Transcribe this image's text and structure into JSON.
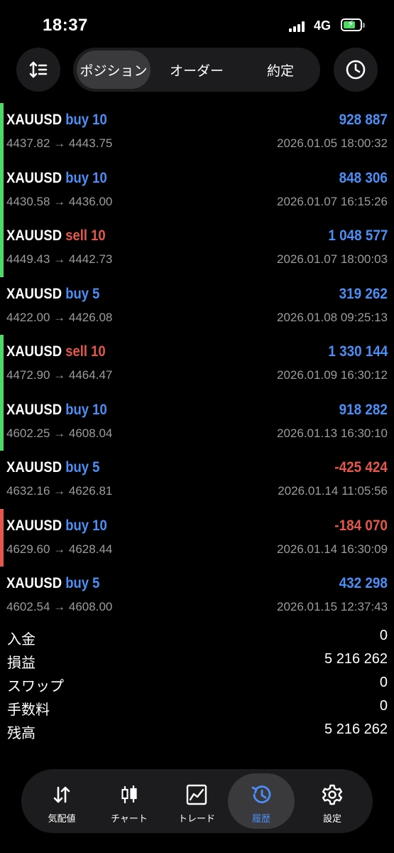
{
  "status_bar": {
    "time": "18:37",
    "network": "4G"
  },
  "tabs": [
    {
      "label": "ポジション",
      "active": true
    },
    {
      "label": "オーダー",
      "active": false
    },
    {
      "label": "約定",
      "active": false
    }
  ],
  "rows": [
    {
      "symbol": "XAUUSD",
      "side": "buy 10",
      "side_type": "buy",
      "prices": "4437.82 → 4443.75",
      "profit": "928 887",
      "profit_sign": "pos",
      "date": "2026.01.05 18:00:32",
      "bar": "#4cd964"
    },
    {
      "symbol": "XAUUSD",
      "side": "buy 10",
      "side_type": "buy",
      "prices": "4430.58 → 4436.00",
      "profit": "848 306",
      "profit_sign": "pos",
      "date": "2026.01.07 16:15:26",
      "bar": "#4cd964"
    },
    {
      "symbol": "XAUUSD",
      "side": "sell 10",
      "side_type": "sell",
      "prices": "4449.43 → 4442.73",
      "profit": "1 048 577",
      "profit_sign": "pos",
      "date": "2026.01.07 18:00:03",
      "bar": "#4cd964"
    },
    {
      "symbol": "XAUUSD",
      "side": "buy 5",
      "side_type": "buy",
      "prices": "4422.00 → 4426.08",
      "profit": "319 262",
      "profit_sign": "pos",
      "date": "2026.01.08 09:25:13",
      "bar": ""
    },
    {
      "symbol": "XAUUSD",
      "side": "sell 10",
      "side_type": "sell",
      "prices": "4472.90 → 4464.47",
      "profit": "1 330 144",
      "profit_sign": "pos",
      "date": "2026.01.09 16:30:12",
      "bar": "#4cd964"
    },
    {
      "symbol": "XAUUSD",
      "side": "buy 10",
      "side_type": "buy",
      "prices": "4602.25 → 4608.04",
      "profit": "918 282",
      "profit_sign": "pos",
      "date": "2026.01.13 16:30:10",
      "bar": "#4cd964"
    },
    {
      "symbol": "XAUUSD",
      "side": "buy 5",
      "side_type": "buy",
      "prices": "4632.16 → 4626.81",
      "profit": "-425 424",
      "profit_sign": "neg",
      "date": "2026.01.14 11:05:56",
      "bar": ""
    },
    {
      "symbol": "XAUUSD",
      "side": "buy 10",
      "side_type": "buy",
      "prices": "4629.60 → 4628.44",
      "profit": "-184 070",
      "profit_sign": "neg",
      "date": "2026.01.14 16:30:09",
      "bar": "#e5574b"
    },
    {
      "symbol": "XAUUSD",
      "side": "buy 5",
      "side_type": "buy",
      "prices": "4602.54 → 4608.00",
      "profit": "432 298",
      "profit_sign": "pos",
      "date": "2026.01.15 12:37:43",
      "bar": ""
    }
  ],
  "summary": [
    {
      "label": "入金",
      "value": "0"
    },
    {
      "label": "損益",
      "value": "5 216 262"
    },
    {
      "label": "スワップ",
      "value": "0"
    },
    {
      "label": "手数料",
      "value": "0"
    },
    {
      "label": "残高",
      "value": "5 216 262"
    }
  ],
  "nav": [
    {
      "label": "気配値",
      "icon": "quotes-arrows-icon",
      "active": false
    },
    {
      "label": "チャート",
      "icon": "candlestick-icon",
      "active": false
    },
    {
      "label": "トレード",
      "icon": "trade-chart-icon",
      "active": false
    },
    {
      "label": "履歴",
      "icon": "history-icon",
      "active": true
    },
    {
      "label": "設定",
      "icon": "gear-icon",
      "active": false
    }
  ],
  "colors": {
    "buy": "#4b8ff6",
    "sell": "#e5574b",
    "profit_pos": "#4b8ff6",
    "profit_neg": "#e5574b",
    "accent": "#4b8ff6"
  }
}
